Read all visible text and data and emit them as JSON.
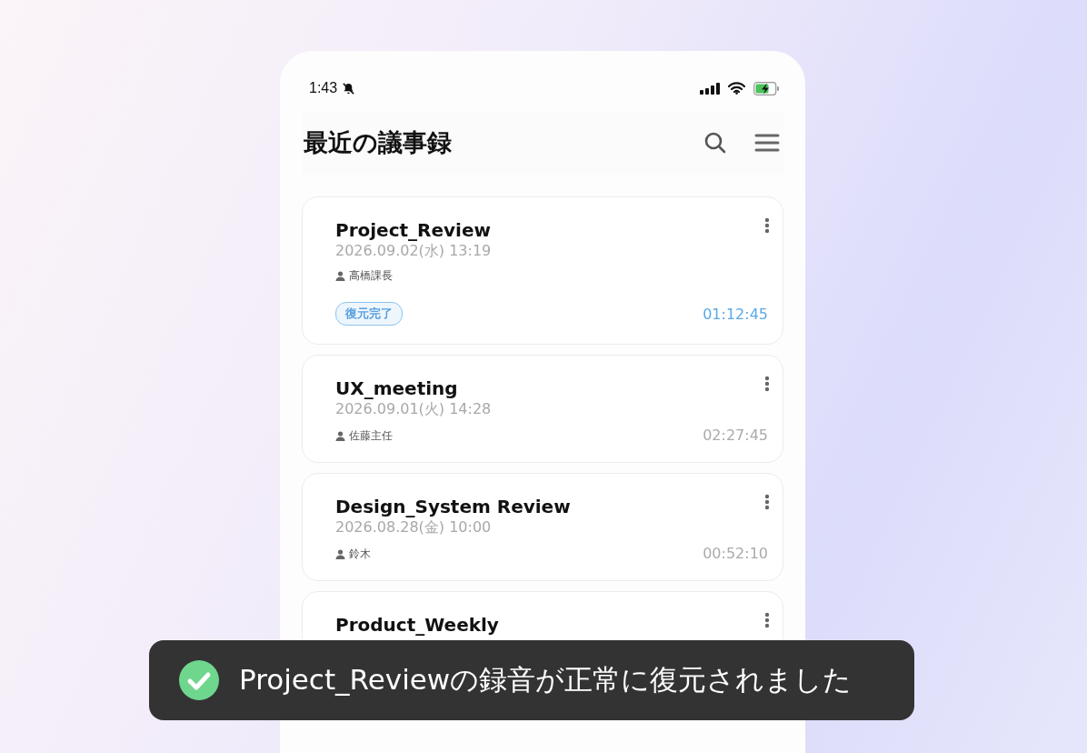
{
  "status_bar": {
    "time": "1:43"
  },
  "header": {
    "title": "最近の議事録"
  },
  "meetings": [
    {
      "title": "Project_Review",
      "datetime": "2026.09.02(水) 13:19",
      "owner": "高橋課長",
      "badge": "復元完了",
      "duration": "01:12:45",
      "highlighted": true
    },
    {
      "title": "UX_meeting",
      "datetime": "2026.09.01(火) 14:28",
      "owner": "佐藤主任",
      "duration": "02:27:45",
      "highlighted": false
    },
    {
      "title": "Design_System Review",
      "datetime": "2026.08.28(金) 10:00",
      "owner": "鈴木",
      "duration": "00:52:10",
      "highlighted": false
    },
    {
      "title": "Product_Weekly"
    }
  ],
  "toast": {
    "message": "Project_Reviewの録音が正常に復元されました"
  }
}
